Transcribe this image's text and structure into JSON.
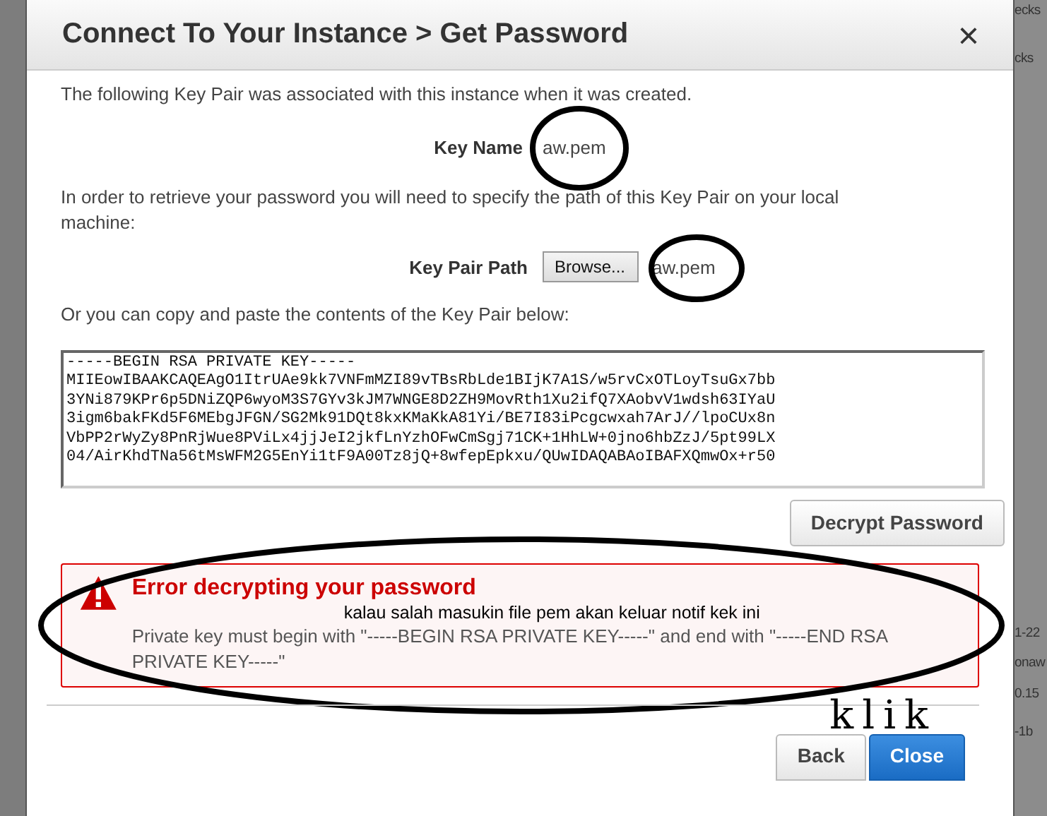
{
  "background_fragments": [
    {
      "text": "ecks"
    },
    {
      "text": "cks"
    },
    {
      "text": "1-22"
    },
    {
      "text": "onaw"
    },
    {
      "text": "0.15"
    },
    {
      "text": "-1b"
    }
  ],
  "dialog": {
    "title": "Connect To Your Instance > Get Password",
    "close": "×",
    "intro": "The following Key Pair was associated with this instance when it was created.",
    "key_name": {
      "label": "Key Name",
      "value": "aw.pem"
    },
    "instruction": "In order to retrieve your password you will need to specify the path of this Key Pair on your local machine:",
    "key_pair_path": {
      "label": "Key Pair Path",
      "button": "Browse...",
      "file": "aw.pem"
    },
    "paste_hint": "Or you can copy and paste the contents of the Key Pair below:",
    "key_text": "-----BEGIN RSA PRIVATE KEY-----\nMIIEowIBAAKCAQEAgO1ItrUAe9kk7VNFmMZI89vTBsRbLde1BIjK7A1S/w5rvCxOTLoyTsuGx7bb\n3YNi879KPr6p5DNiZQP6wyoM3S7GYv3kJM7WNGE8D2ZH9MovRth1Xu2ifQ7XAobvV1wdsh63IYaU\n3igm6bakFKd5F6MEbgJFGN/SG2Mk91DQt8kxKMaKkA81Yi/BE7I83iPcgcwxah7ArJ//lpoCUx8n\nVbPP2rWyZy8PnRjWue8PViLx4jjJeI2jkfLnYzhOFwCmSgj71CK+1HhLW+0jno6hbZzJ/5pt99LX\n04/AirKhdTNa56tMsWFM2G5EnYi1tF9A00Tz8jQ+8wfepEpkxu/QUwIDAQABAoIBAFXQmwOx+r50",
    "decrypt_button": "Decrypt Password",
    "error": {
      "title": "Error decrypting your password",
      "message": "Private key must begin with \"-----BEGIN RSA PRIVATE KEY-----\" and end with \"-----END RSA PRIVATE KEY-----\""
    },
    "buttons": [
      {
        "label": "Back",
        "kind": "secondary"
      },
      {
        "label": "Close",
        "kind": "primary"
      }
    ]
  },
  "annotations": {
    "note": "kalau salah masukin file pem akan keluar notif kek ini",
    "click_note": "klik"
  }
}
